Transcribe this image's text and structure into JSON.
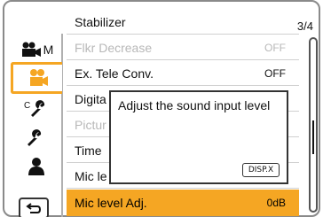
{
  "menu": {
    "items": [
      {
        "label": "Stabilizer",
        "value": ""
      },
      {
        "label": "Flkr Decrease",
        "value": "OFF",
        "dim": true
      },
      {
        "label": "Ex. Tele Conv.",
        "value": "OFF"
      },
      {
        "label": "Digita",
        "value": ""
      },
      {
        "label": "Pictur",
        "value": "",
        "dim": true
      },
      {
        "label": "Time",
        "value": ""
      },
      {
        "label": "Mic le",
        "value": ""
      },
      {
        "label": "Mic level Adj.",
        "value": "0dB",
        "selected": true
      }
    ]
  },
  "popup": {
    "text": "Adjust the sound input level",
    "button_label": "DISP.X"
  },
  "page": {
    "counter": "3/4"
  },
  "tabs": {
    "movie_mode_label": "M",
    "icons": [
      "movie-camera-m-icon",
      "movie-camera-icon",
      "custom-wrench-icon",
      "wrench-icon",
      "person-icon"
    ]
  },
  "back_icon": "return-arrow-icon",
  "scrollbar": {
    "position_fraction": 0.5
  },
  "colors": {
    "accent": "#f5a623"
  }
}
